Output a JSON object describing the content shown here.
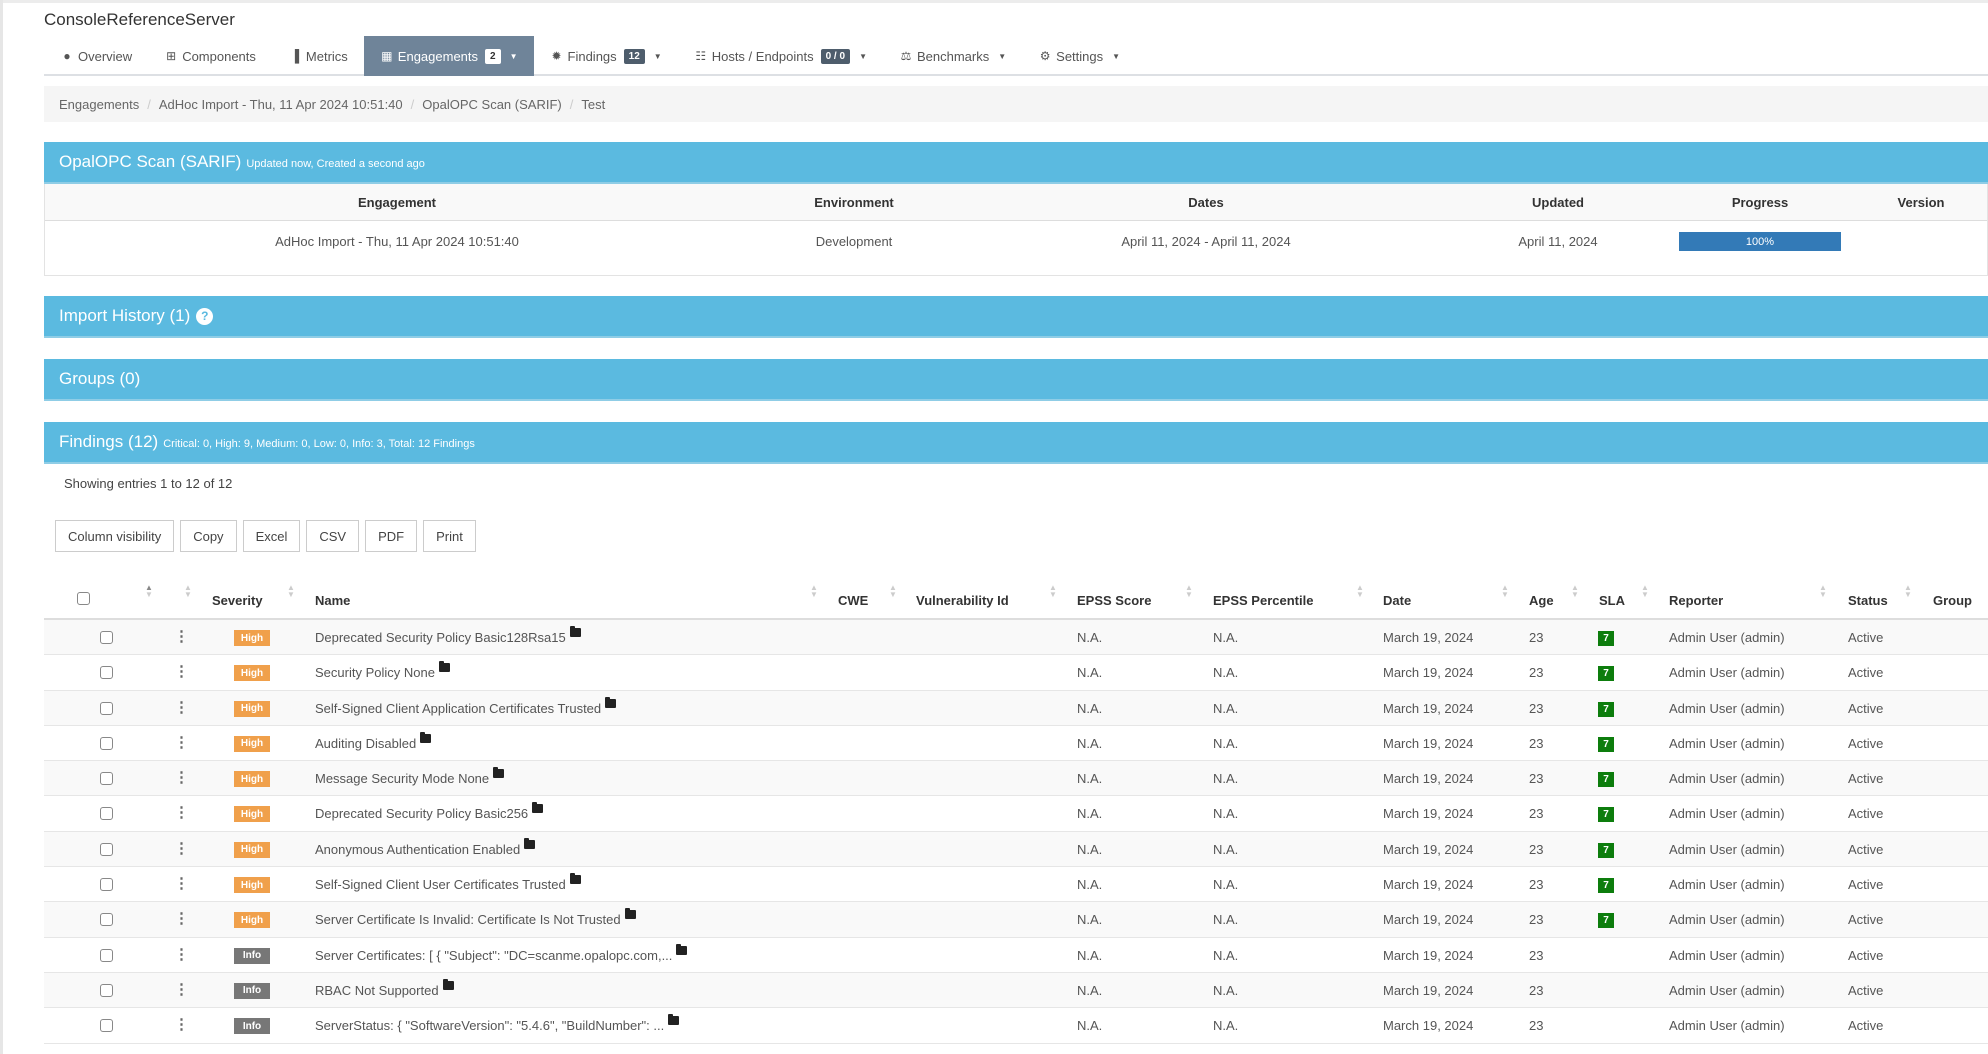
{
  "app_title": "ConsoleReferenceServer",
  "nav": {
    "tabs": [
      {
        "label": "Overview",
        "icon": "globe-icon",
        "glyph": "●"
      },
      {
        "label": "Components",
        "icon": "table-icon",
        "glyph": "⊞"
      },
      {
        "label": "Metrics",
        "icon": "bar-chart-icon",
        "glyph": "▐"
      },
      {
        "label": "Engagements",
        "icon": "calendar-icon",
        "glyph": "▦",
        "badge": "2",
        "dropdown": true,
        "active": true
      },
      {
        "label": "Findings",
        "icon": "bug-icon",
        "glyph": "✹",
        "badge": "12",
        "dropdown": true
      },
      {
        "label": "Hosts / Endpoints",
        "icon": "sitemap-icon",
        "glyph": "☷",
        "badge": "0 / 0",
        "dropdown": true
      },
      {
        "label": "Benchmarks",
        "icon": "balance-scale-icon",
        "glyph": "⚖",
        "dropdown": true
      },
      {
        "label": "Settings",
        "icon": "gears-icon",
        "glyph": "⚙",
        "dropdown": true
      }
    ]
  },
  "breadcrumb": [
    "Engagements",
    "AdHoc Import - Thu, 11 Apr 2024 10:51:40",
    "OpalOPC Scan (SARIF)",
    "Test"
  ],
  "test_panel": {
    "title": "OpalOPC Scan (SARIF)",
    "subtitle": "Updated now, Created a second ago",
    "columns": [
      "Engagement",
      "Environment",
      "Dates",
      "Updated",
      "Progress",
      "Version"
    ],
    "row": {
      "engagement": "AdHoc Import - Thu, 11 Apr 2024 10:51:40",
      "environment": "Development",
      "dates": "April 11, 2024 - April 11, 2024",
      "updated": "April 11, 2024",
      "progress_percent": 100,
      "progress_label": "100%",
      "version": ""
    }
  },
  "import_history": {
    "title": "Import History (1)",
    "help_icon": "question-circle-icon",
    "help_glyph": "?"
  },
  "groups": {
    "title": "Groups (0)"
  },
  "findings": {
    "title": "Findings (12)",
    "summary": "Critical: 0, High: 9, Medium: 0, Low: 0, Info: 3, Total: 12 Findings",
    "showing": "Showing entries 1 to 12 of 12",
    "buttons": [
      "Column visibility",
      "Copy",
      "Excel",
      "CSV",
      "PDF",
      "Print"
    ],
    "columns": [
      "Severity",
      "Name",
      "CWE",
      "Vulnerability Id",
      "EPSS Score",
      "EPSS Percentile",
      "Date",
      "Age",
      "SLA",
      "Reporter",
      "Status",
      "Group"
    ],
    "rows": [
      {
        "severity": "High",
        "name": "Deprecated Security Policy Basic128Rsa15",
        "cwe": "",
        "vuln_id": "",
        "epss_score": "N.A.",
        "epss_pct": "N.A.",
        "date": "March 19, 2024",
        "age": "23",
        "sla": "7",
        "reporter": "Admin User (admin)",
        "status": "Active",
        "group": ""
      },
      {
        "severity": "High",
        "name": "Security Policy None",
        "cwe": "",
        "vuln_id": "",
        "epss_score": "N.A.",
        "epss_pct": "N.A.",
        "date": "March 19, 2024",
        "age": "23",
        "sla": "7",
        "reporter": "Admin User (admin)",
        "status": "Active",
        "group": ""
      },
      {
        "severity": "High",
        "name": "Self-Signed Client Application Certificates Trusted",
        "cwe": "",
        "vuln_id": "",
        "epss_score": "N.A.",
        "epss_pct": "N.A.",
        "date": "March 19, 2024",
        "age": "23",
        "sla": "7",
        "reporter": "Admin User (admin)",
        "status": "Active",
        "group": ""
      },
      {
        "severity": "High",
        "name": "Auditing Disabled",
        "cwe": "",
        "vuln_id": "",
        "epss_score": "N.A.",
        "epss_pct": "N.A.",
        "date": "March 19, 2024",
        "age": "23",
        "sla": "7",
        "reporter": "Admin User (admin)",
        "status": "Active",
        "group": ""
      },
      {
        "severity": "High",
        "name": "Message Security Mode None",
        "cwe": "",
        "vuln_id": "",
        "epss_score": "N.A.",
        "epss_pct": "N.A.",
        "date": "March 19, 2024",
        "age": "23",
        "sla": "7",
        "reporter": "Admin User (admin)",
        "status": "Active",
        "group": ""
      },
      {
        "severity": "High",
        "name": "Deprecated Security Policy Basic256",
        "cwe": "",
        "vuln_id": "",
        "epss_score": "N.A.",
        "epss_pct": "N.A.",
        "date": "March 19, 2024",
        "age": "23",
        "sla": "7",
        "reporter": "Admin User (admin)",
        "status": "Active",
        "group": ""
      },
      {
        "severity": "High",
        "name": "Anonymous Authentication Enabled",
        "cwe": "",
        "vuln_id": "",
        "epss_score": "N.A.",
        "epss_pct": "N.A.",
        "date": "March 19, 2024",
        "age": "23",
        "sla": "7",
        "reporter": "Admin User (admin)",
        "status": "Active",
        "group": ""
      },
      {
        "severity": "High",
        "name": "Self-Signed Client User Certificates Trusted",
        "cwe": "",
        "vuln_id": "",
        "epss_score": "N.A.",
        "epss_pct": "N.A.",
        "date": "March 19, 2024",
        "age": "23",
        "sla": "7",
        "reporter": "Admin User (admin)",
        "status": "Active",
        "group": ""
      },
      {
        "severity": "High",
        "name": "Server Certificate Is Invalid: Certificate Is Not Trusted",
        "cwe": "",
        "vuln_id": "",
        "epss_score": "N.A.",
        "epss_pct": "N.A.",
        "date": "March 19, 2024",
        "age": "23",
        "sla": "7",
        "reporter": "Admin User (admin)",
        "status": "Active",
        "group": ""
      },
      {
        "severity": "Info",
        "name": "Server Certificates: [ { \"Subject\": \"DC=scanme.opalopc.com,...",
        "cwe": "",
        "vuln_id": "",
        "epss_score": "N.A.",
        "epss_pct": "N.A.",
        "date": "March 19, 2024",
        "age": "23",
        "sla": "",
        "reporter": "Admin User (admin)",
        "status": "Active",
        "group": ""
      },
      {
        "severity": "Info",
        "name": "RBAC Not Supported",
        "cwe": "",
        "vuln_id": "",
        "epss_score": "N.A.",
        "epss_pct": "N.A.",
        "date": "March 19, 2024",
        "age": "23",
        "sla": "",
        "reporter": "Admin User (admin)",
        "status": "Active",
        "group": ""
      },
      {
        "severity": "Info",
        "name": "ServerStatus: { \"SoftwareVersion\": \"5.4.6\", \"BuildNumber\": ...",
        "cwe": "",
        "vuln_id": "",
        "epss_score": "N.A.",
        "epss_pct": "N.A.",
        "date": "March 19, 2024",
        "age": "23",
        "sla": "",
        "reporter": "Admin User (admin)",
        "status": "Active",
        "group": ""
      }
    ]
  },
  "colors": {
    "panel_header": "#5bbae0",
    "active_tab": "#6f8499",
    "severity_high": "#f0a04b",
    "severity_info": "#777777",
    "sla_ok": "#0d7d0d",
    "progress": "#337ab7"
  }
}
